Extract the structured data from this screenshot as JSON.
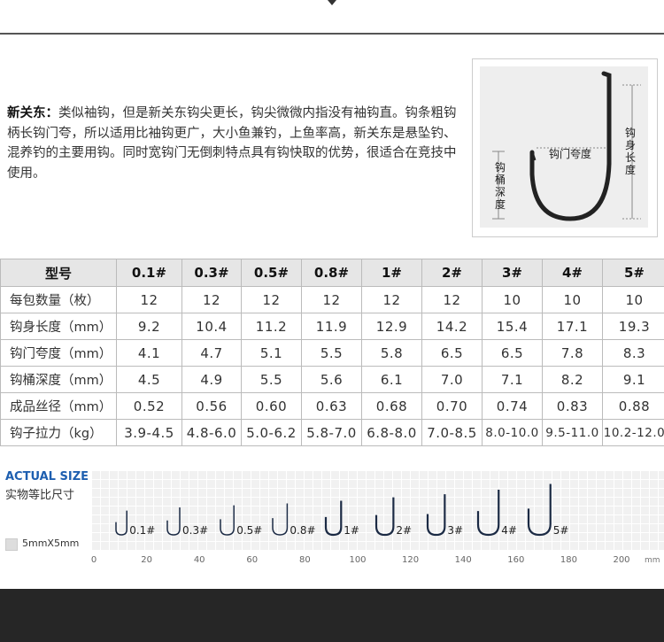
{
  "description": {
    "title": "新关东：",
    "text": "类似袖钩，但是新关东钩尖更长，钩尖微微内指没有袖钩直。钩条粗钩柄长钩门夸，所以适用比袖钩更广，大小鱼兼钓，上鱼率高，新关东是悬坠钓、混养钓的主要用钩。同时宽钩门无倒刺特点具有钩快取的优势，很适合在竞技中使用。"
  },
  "diagram": {
    "gape_label": "钩门夸度",
    "shank_label": "钩身长度",
    "depth_label": "钩桶深度"
  },
  "table": {
    "header_label": "型号",
    "sizes": [
      "0.1#",
      "0.3#",
      "0.5#",
      "0.8#",
      "1#",
      "2#",
      "3#",
      "4#",
      "5#"
    ],
    "rows": [
      {
        "label": "每包数量（枚）",
        "values": [
          "12",
          "12",
          "12",
          "12",
          "12",
          "12",
          "10",
          "10",
          "10"
        ]
      },
      {
        "label": "钩身长度（mm）",
        "values": [
          "9.2",
          "10.4",
          "11.2",
          "11.9",
          "12.9",
          "14.2",
          "15.4",
          "17.1",
          "19.3"
        ]
      },
      {
        "label": "钩门夸度（mm）",
        "values": [
          "4.1",
          "4.7",
          "5.1",
          "5.5",
          "5.8",
          "6.5",
          "6.5",
          "7.8",
          "8.3"
        ]
      },
      {
        "label": "钩桶深度（mm）",
        "values": [
          "4.5",
          "4.9",
          "5.5",
          "5.6",
          "6.1",
          "7.0",
          "7.1",
          "8.2",
          "9.1"
        ]
      },
      {
        "label": "成品丝径（mm）",
        "values": [
          "0.52",
          "0.56",
          "0.60",
          "0.63",
          "0.68",
          "0.70",
          "0.74",
          "0.83",
          "0.88"
        ]
      },
      {
        "label": "钩子拉力（kg）",
        "values": [
          "3.9-4.5",
          "4.8-6.0",
          "5.0-6.2",
          "5.8-7.0",
          "6.8-8.0",
          "7.0-8.5",
          "8.0-10.0",
          "9.5-11.0",
          "10.2-12.0"
        ]
      }
    ]
  },
  "actual_size": {
    "title": "ACTUAL SIZE",
    "subtitle": "实物等比尺寸",
    "legend": "5mmX5mm",
    "ruler_ticks": [
      "0",
      "20",
      "40",
      "60",
      "80",
      "100",
      "120",
      "140",
      "160",
      "180",
      "200"
    ],
    "unit": "mm",
    "hook_labels": [
      "0.1#",
      "0.3#",
      "0.5#",
      "0.8#",
      "1#",
      "2#",
      "3#",
      "4#",
      "5#"
    ]
  },
  "colors": {
    "accent_blue": "#1e5fb0",
    "footer_dark": "#262626"
  }
}
